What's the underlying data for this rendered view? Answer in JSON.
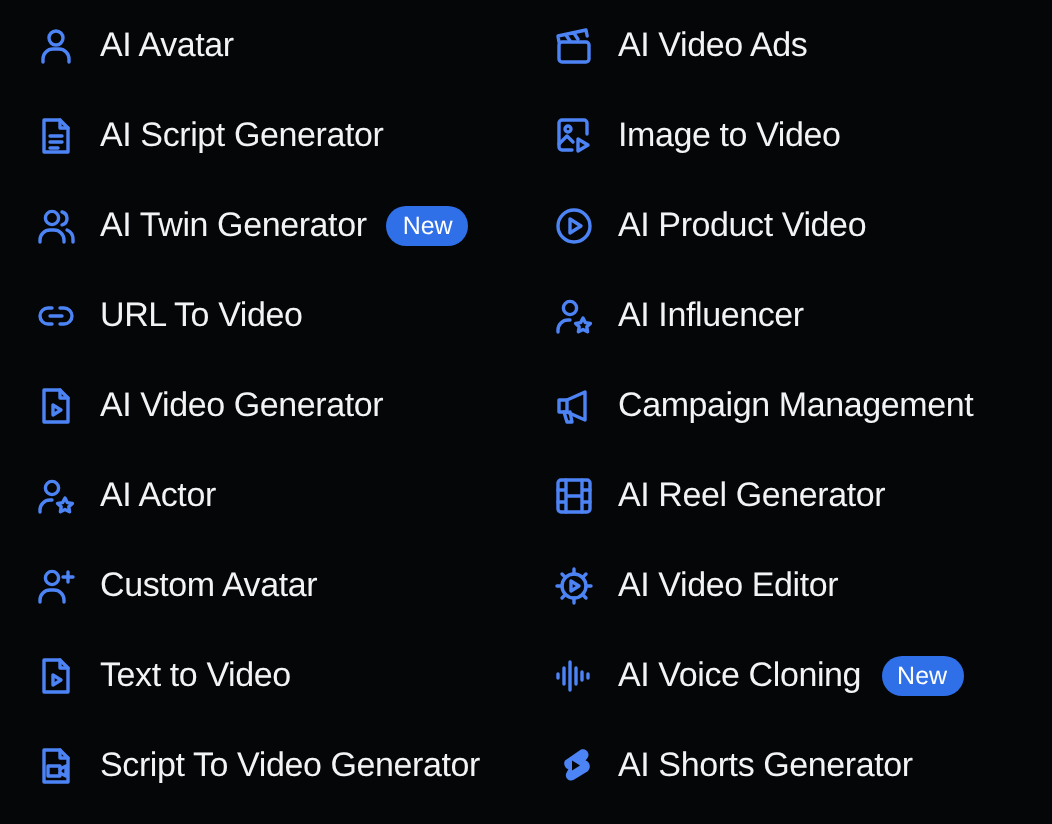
{
  "columns": [
    {
      "items": [
        {
          "label": "AI Avatar"
        },
        {
          "label": "AI Script Generator"
        },
        {
          "label": "AI Twin Generator",
          "badge": "New"
        },
        {
          "label": "URL To Video"
        },
        {
          "label": "AI Video Generator"
        },
        {
          "label": "AI Actor"
        },
        {
          "label": "Custom Avatar"
        },
        {
          "label": "Text to Video"
        },
        {
          "label": "Script To Video Generator"
        }
      ]
    },
    {
      "items": [
        {
          "label": "AI Video Ads"
        },
        {
          "label": "Image to Video"
        },
        {
          "label": "AI Product Video"
        },
        {
          "label": "AI Influencer"
        },
        {
          "label": "Campaign Management"
        },
        {
          "label": "AI Reel Generator"
        },
        {
          "label": "AI Video Editor"
        },
        {
          "label": "AI Voice Cloning",
          "badge": "New"
        },
        {
          "label": "AI Shorts Generator"
        }
      ]
    }
  ]
}
